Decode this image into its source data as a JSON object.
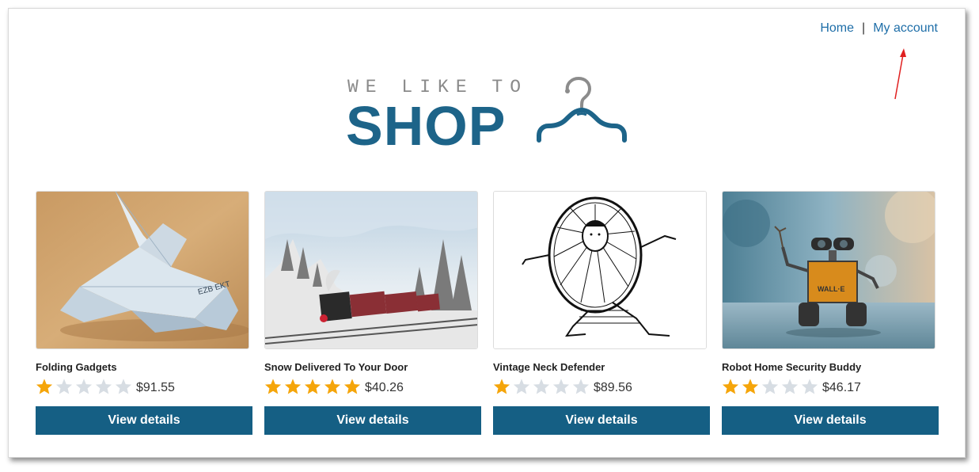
{
  "nav": {
    "home_label": "Home",
    "separator": "|",
    "account_label": "My account"
  },
  "logo": {
    "tagline": "WE LIKE TO",
    "brand": "SHOP",
    "icon": "hanger-icon"
  },
  "colors": {
    "primary": "#155f84",
    "link": "#1e6ea8",
    "star_filled": "#f5a50a",
    "star_empty": "#d7dde3",
    "annotation_arrow": "#e02020"
  },
  "products": [
    {
      "name": "Folding Gadgets",
      "rating": 1,
      "max_rating": 5,
      "price": "$91.55",
      "button_label": "View details",
      "image": "origami-bird-image"
    },
    {
      "name": "Snow Delivered To Your Door",
      "rating": 5,
      "max_rating": 5,
      "price": "$40.26",
      "button_label": "View details",
      "image": "snowy-train-image"
    },
    {
      "name": "Vintage Neck Defender",
      "rating": 1,
      "max_rating": 5,
      "price": "$89.56",
      "button_label": "View details",
      "image": "ruff-collar-sketch-image"
    },
    {
      "name": "Robot Home Security Buddy",
      "rating": 2,
      "max_rating": 5,
      "price": "$46.17",
      "button_label": "View details",
      "image": "toy-robot-image"
    }
  ]
}
